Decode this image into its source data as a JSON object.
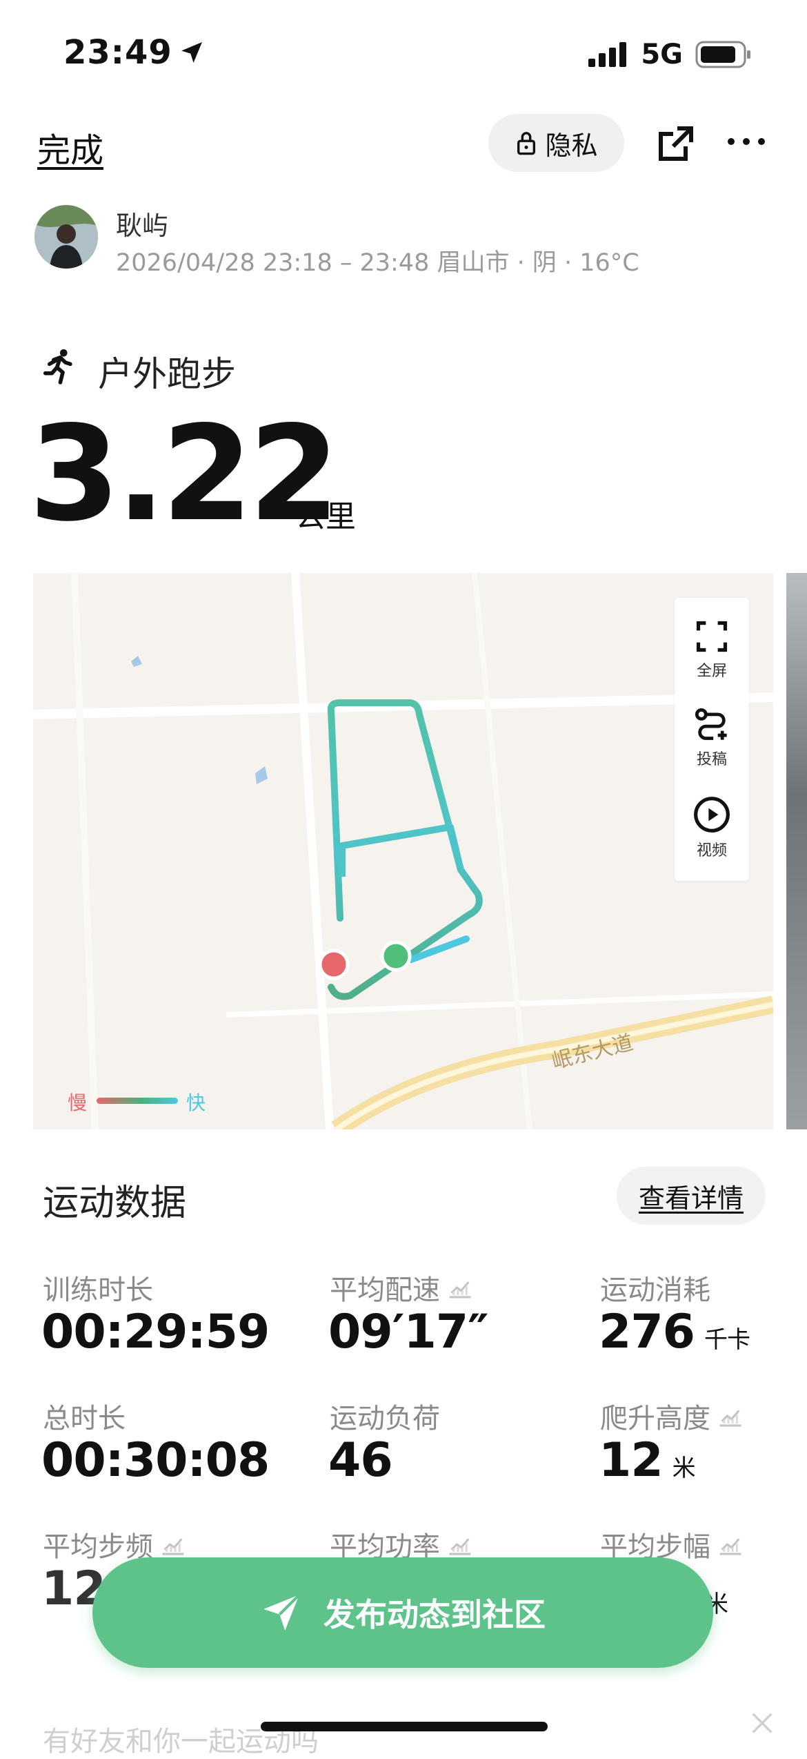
{
  "status": {
    "time": "23:49",
    "network": "5G"
  },
  "header": {
    "done_label": "完成",
    "privacy_label": "隐私"
  },
  "user": {
    "name": "耿屿",
    "meta": "2026/04/28 23:18 – 23:48 眉山市 · 阴 · 16°C"
  },
  "activity": {
    "type": "户外跑步",
    "distance": "3.22",
    "distance_unit": "公里"
  },
  "map": {
    "tools": [
      {
        "icon": "fullscreen-icon",
        "label": "全屏"
      },
      {
        "icon": "route-plus-icon",
        "label": "投稿"
      },
      {
        "icon": "play-video-icon",
        "label": "视频"
      }
    ],
    "road_label": "岷东大道",
    "legend_slow": "慢",
    "legend_fast": "快",
    "colors": {
      "slow": "#e5676a",
      "mid": "#4caf7d",
      "fast": "#4ec8e0"
    }
  },
  "stats": {
    "title": "运动数据",
    "details_label": "查看详情",
    "items": [
      {
        "label": "训练时长",
        "value": "00:29:59",
        "unit": ""
      },
      {
        "label": "平均配速",
        "value": "09′17″",
        "unit": ""
      },
      {
        "label": "运动消耗",
        "value": "276",
        "unit": "千卡"
      },
      {
        "label": "总时长",
        "value": "00:30:08",
        "unit": ""
      },
      {
        "label": "运动负荷",
        "value": "46",
        "unit": ""
      },
      {
        "label": "爬升高度",
        "value": "12",
        "unit": "米"
      },
      {
        "label": "平均步频",
        "value": "128",
        "unit": ""
      },
      {
        "label": "平均功率",
        "value": "",
        "unit": ""
      },
      {
        "label": "平均步幅",
        "value": "",
        "unit": "米"
      }
    ]
  },
  "publish_label": "发布动态到社区",
  "bottom_cut_text": "有好友和你一起运动吗",
  "accent_color": "#5ec38a"
}
